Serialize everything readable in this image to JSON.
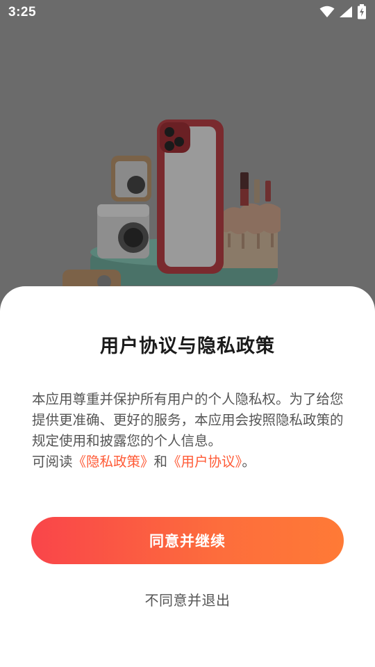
{
  "status_bar": {
    "time": "3:25",
    "icons": [
      "wifi-icon",
      "signal-icon",
      "battery-charging-icon"
    ]
  },
  "dialog": {
    "title": "用户协议与隐私政策",
    "body_line": "本应用尊重并保护所有用户的个人隐私权。为了给您提供更准确、更好的服务，本应用会按照隐私政策的规定使用和披露您的个人信息。",
    "read_prefix": "可阅读",
    "privacy_link": "《隐私政策》",
    "conjunction": "和",
    "agreement_link": "《用户协议》",
    "read_suffix": "。",
    "agree_button": "同意并继续",
    "decline_button": "不同意并退出"
  },
  "colors": {
    "overlay": "#6b6b6b",
    "link": "#ff5a36",
    "button_gradient_start": "#f9454a",
    "button_gradient_end": "#ff7a36"
  }
}
